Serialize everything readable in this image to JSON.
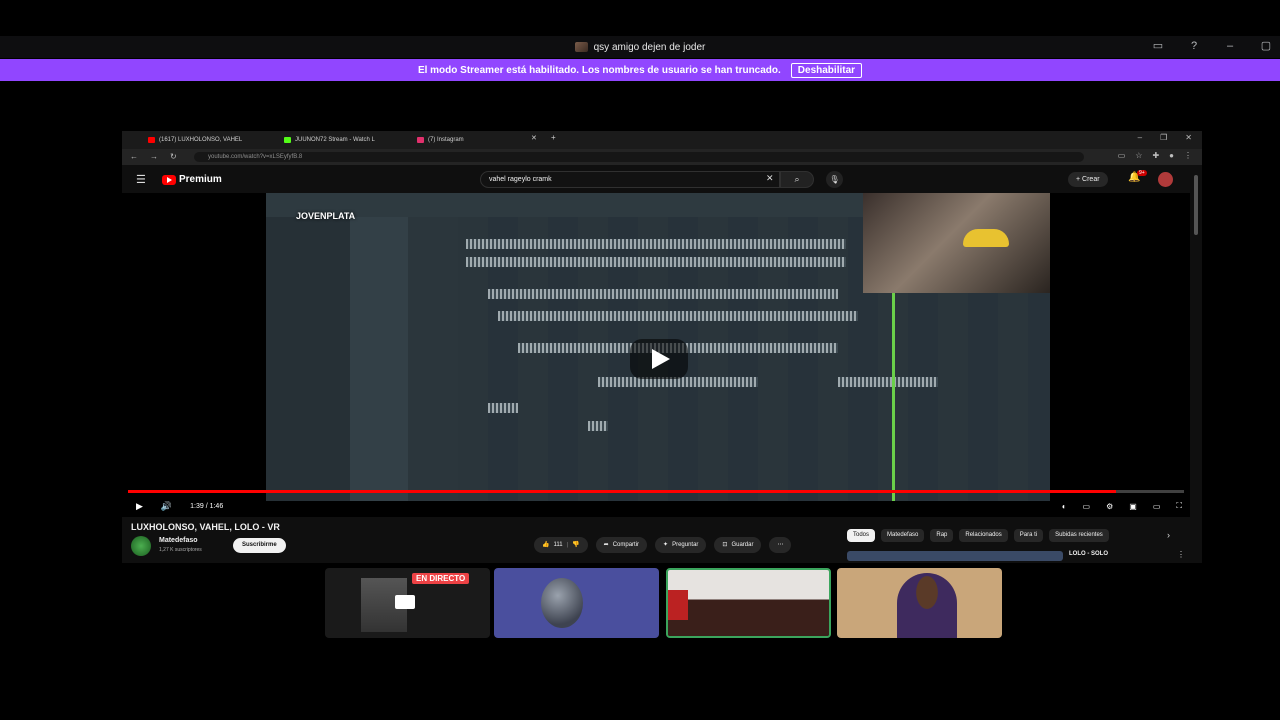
{
  "titlebar": {
    "channel": "qsy amigo dejen de joder"
  },
  "banner": {
    "text": "El modo Streamer está habilitado. Los nombres de usuario se han truncado.",
    "button": "Deshabilitar"
  },
  "browser": {
    "tabs": [
      {
        "label": "(1617) LUXHOLONSO, VAHEL",
        "color": "#ff0000"
      },
      {
        "label": "JUUNON72 Stream - Watch L",
        "color": "#53fc18"
      },
      {
        "label": "(7) Instagram",
        "color": "#e1306c"
      }
    ],
    "url": "youtube.com/watch?v=xLSEyfyfB.8"
  },
  "youtube": {
    "logo": "Premium",
    "search_query": "vahel rageylo cramk",
    "create": "Crear",
    "notif_badge": "9+",
    "time": "1:39 / 1:46",
    "progress_pct": 93.6,
    "daw_overlay": "JOVENPLATA",
    "video_title": "LUXHOLONSO, VAHEL, LOLO - VR",
    "channel_name": "Matedefaso",
    "subscribers": "1,27 K suscriptores",
    "subscribe": "Suscribirme",
    "likes": "111",
    "share": "Compartir",
    "ask": "Preguntar",
    "save": "Guardar",
    "chips": [
      "Todos",
      "Matedefaso",
      "Rap",
      "Relacionados",
      "Para ti",
      "Subidas recientes"
    ],
    "rec_title": "LOLO - SOLO"
  },
  "participants": {
    "live_badge": "EN DIRECTO"
  },
  "colors": {
    "accent": "#9146ff",
    "yt_red": "#ff0000",
    "speaking": "#3ba55d"
  }
}
